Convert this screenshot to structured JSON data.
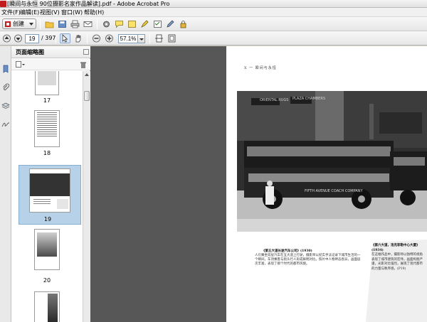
{
  "window": {
    "title": "[瞬间与永恒  90位摄影名家作品解读].pdf - Adobe Acrobat Pro"
  },
  "menu": {
    "items": [
      "文件(F)",
      "编辑(E)",
      "视图(V)",
      "窗口(W)",
      "帮助(H)"
    ]
  },
  "toolbar": {
    "create_label": "创建",
    "page_current": "19",
    "page_total": "/ 397",
    "zoom_value": "57.1%"
  },
  "panel": {
    "title": "页面缩略图"
  },
  "thumbnails": [
    {
      "label": "17"
    },
    {
      "label": "18"
    },
    {
      "label": "19"
    },
    {
      "label": "20"
    }
  ],
  "document": {
    "running_head": "X   一   瞬间与永恒",
    "bus_sign_top_left": "ORIENTAL RUGS",
    "bus_sign_top_right": "PLAZA CHAMBERS",
    "bus_side_text": "FIFTH AVENUE COACH COMPANY",
    "caption_title": "《第五大道长途汽车公司》(1930)",
    "caption_body": "人们乘坐双层汽车在五大道上行驶，摄影师以纪实手法记录下城市生活的一个瞬间，车顶乘客与街头行人形成鲜明对比。照片中人物神态各异，画面层次丰富，表现了那个时代的都市风貌。",
    "side_caption_title": "《第六大道，洛克菲勒中心大厦》(1934)",
    "side_caption_body": "在这幅作品中，摄影师以独特的视角表现了城市建筑的宏伟，画面构图严谨，光影对比强烈，展现了现代都市的力量与秩序感。(P19)"
  },
  "colors": {
    "gutter": "#575757",
    "selection": "#b7d2e8",
    "acrobat_red": "#c21d1d"
  }
}
